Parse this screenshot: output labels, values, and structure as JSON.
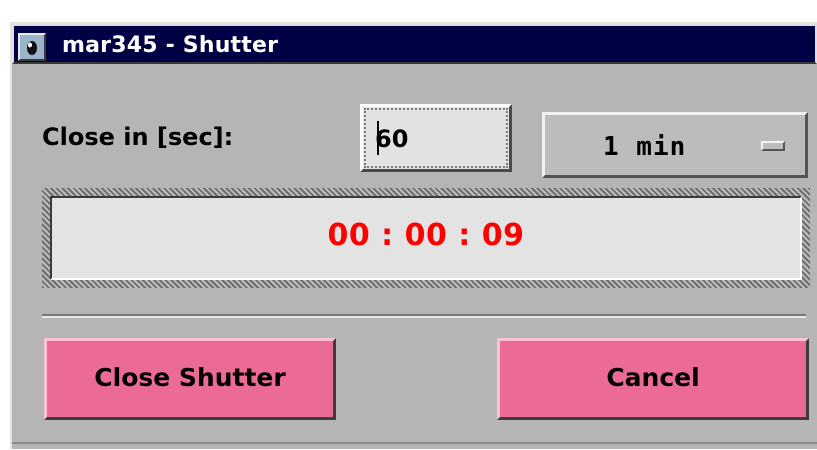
{
  "window": {
    "title": "mar345 - Shutter",
    "icon": "mar345-app-icon"
  },
  "form": {
    "close_label": "Close in [sec]:",
    "close_value": "60",
    "interval_selected": "1 min"
  },
  "timer": {
    "display": "00 : 00 : 09",
    "color": "#ff0000"
  },
  "buttons": {
    "close_shutter": "Close Shutter",
    "cancel": "Cancel",
    "color": "#ec6a96"
  }
}
